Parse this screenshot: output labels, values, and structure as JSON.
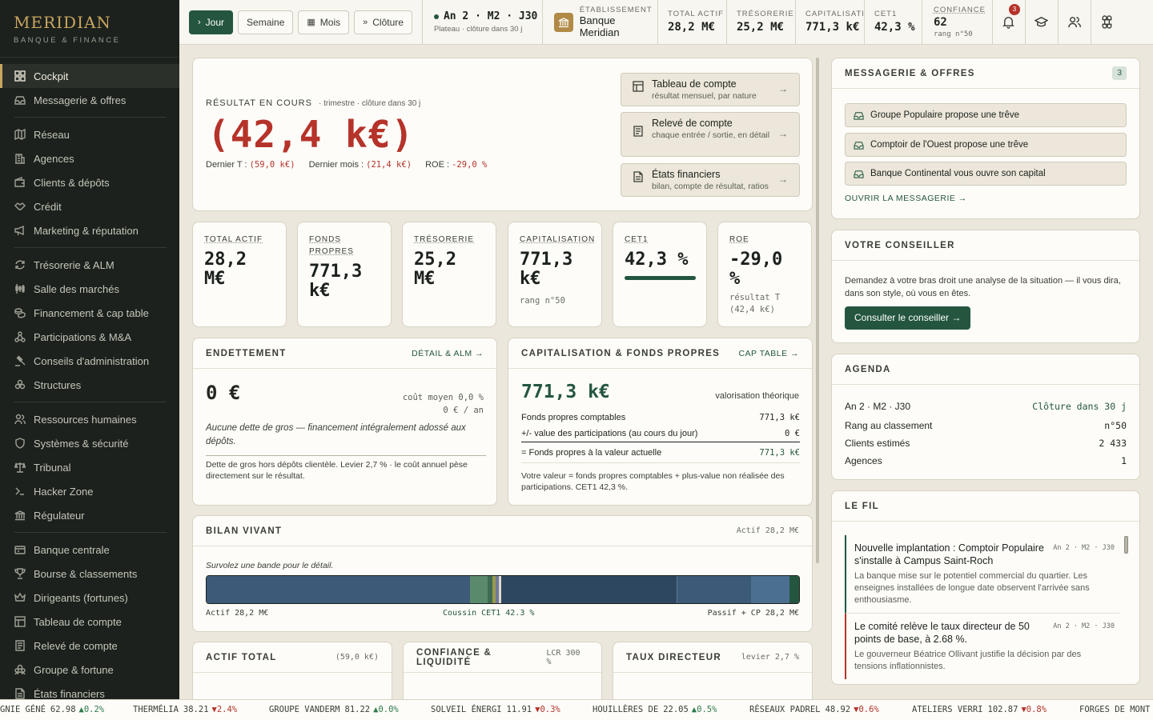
{
  "brand": {
    "name": "MERIDIAN",
    "subtitle": "BANQUE & FINANCE"
  },
  "sidebar": {
    "items": [
      {
        "label": "Cockpit",
        "icon": "dashboard-icon",
        "active": true
      },
      {
        "label": "Messagerie & offres",
        "icon": "inbox-icon"
      },
      {
        "label": "Réseau",
        "icon": "map-icon"
      },
      {
        "label": "Agences",
        "icon": "building-icon"
      },
      {
        "label": "Clients & dépôts",
        "icon": "wallet-icon"
      },
      {
        "label": "Crédit",
        "icon": "handshake-icon"
      },
      {
        "label": "Marketing & réputation",
        "icon": "megaphone-icon"
      },
      {
        "label": "Trésorerie & ALM",
        "icon": "cycle-icon"
      },
      {
        "label": "Salle des marchés",
        "icon": "candles-icon"
      },
      {
        "label": "Financement & cap table",
        "icon": "coins-icon"
      },
      {
        "label": "Participations & M&A",
        "icon": "network-icon"
      },
      {
        "label": "Conseils d'administration",
        "icon": "gavel-icon"
      },
      {
        "label": "Structures",
        "icon": "layers-icon"
      },
      {
        "label": "Ressources humaines",
        "icon": "users-icon"
      },
      {
        "label": "Systèmes & sécurité",
        "icon": "shield-icon"
      },
      {
        "label": "Tribunal",
        "icon": "scales-icon"
      },
      {
        "label": "Hacker Zone",
        "icon": "terminal-icon"
      },
      {
        "label": "Régulateur",
        "icon": "landmark-icon"
      },
      {
        "label": "Banque centrale",
        "icon": "bank-icon"
      },
      {
        "label": "Bourse & classements",
        "icon": "trophy-icon"
      },
      {
        "label": "Dirigeants (fortunes)",
        "icon": "crown-icon"
      },
      {
        "label": "Tableau de compte",
        "icon": "table-icon"
      },
      {
        "label": "Relevé de compte",
        "icon": "receipt-icon"
      },
      {
        "label": "Groupe & fortune",
        "icon": "group-icon"
      },
      {
        "label": "États financiers",
        "icon": "document-icon"
      }
    ]
  },
  "topbar": {
    "buttons": [
      {
        "label": "Jour",
        "glyph": "›"
      },
      {
        "label": "Semaine",
        "glyph": ""
      },
      {
        "label": "Mois",
        "glyph": "▦"
      },
      {
        "label": "Clôture",
        "glyph": "»"
      }
    ],
    "date": "An 2 · M2 · J30",
    "date_sub": "Plateau · clôture dans 30 j",
    "establishment_label": "ÉTABLISSEMENT",
    "establishment": "Banque Meridian",
    "stats": [
      {
        "label": "TOTAL ACTIF",
        "value": "28,2 M€"
      },
      {
        "label": "TRÉSORERIE",
        "value": "25,2 M€"
      },
      {
        "label": "CAPITALISATION",
        "value": "771,3 k€"
      },
      {
        "label": "CET1",
        "value": "42,3 %"
      }
    ],
    "confidence_label": "CONFIANCE",
    "confidence": "62",
    "rank": "rang n°50",
    "notifications": "3"
  },
  "result": {
    "label": "RÉSULTAT EN COURS",
    "context": "· trimestre · clôture dans 30 j",
    "value": "(42,4 k€)",
    "last_t_label": "Dernier T :",
    "last_t": "(59,0 k€)",
    "last_m_label": "Dernier mois :",
    "last_m": "(21,4 k€)",
    "roe_label": "ROE :",
    "roe": "-29,0 %"
  },
  "links": [
    {
      "title": "Tableau de compte",
      "sub": "résultat mensuel, par nature"
    },
    {
      "title": "Relevé de compte",
      "sub": "chaque entrée / sortie, en détail"
    },
    {
      "title": "États financiers",
      "sub": "bilan, compte de résultat, ratios"
    }
  ],
  "kpis": [
    {
      "label": "TOTAL ACTIF",
      "value": "28,2 M€",
      "sub": ""
    },
    {
      "label": "FONDS PROPRES",
      "value": "771,3 k€",
      "sub": ""
    },
    {
      "label": "TRÉSORERIE",
      "value": "25,2 M€",
      "sub": ""
    },
    {
      "label": "CAPITALISATION",
      "value": "771,3 k€",
      "sub": "rang n°50"
    },
    {
      "label": "CET1",
      "value": "42,3 %",
      "sub": ""
    },
    {
      "label": "ROE",
      "value": "-29,0 %",
      "sub": "résultat T (42,4 k€)"
    }
  ],
  "cet1_fill": 0.423,
  "debt": {
    "title": "ENDETTEMENT",
    "link": "DÉTAIL & ALM →",
    "value": "0 €",
    "cost_line1": "coût moyen 0,0 %",
    "cost_line2": "0 € / an",
    "note": "Aucune dette de gros — financement intégralement adossé aux dépôts.",
    "detail": "Dette de gros hors dépôts clientèle. Levier 2,7 % · le coût annuel pèse directement sur le résultat."
  },
  "cap": {
    "title": "CAPITALISATION & FONDS PROPRES",
    "link": "CAP TABLE →",
    "value": "771,3 k€",
    "value_note": "valorisation théorique",
    "rows": [
      {
        "label": "Fonds propres comptables",
        "value": "771,3 k€"
      },
      {
        "label": "+/- value des participations (au cours du jour)",
        "value": "0 €"
      },
      {
        "label": "= Fonds propres à la valeur actuelle",
        "value": "771,3 k€"
      }
    ],
    "note": "Votre valeur = fonds propres comptables + plus-value non réalisée des participations. CET1 42,3 %."
  },
  "bilan": {
    "title": "BILAN VIVANT",
    "right": "Actif 28,2 M€",
    "hint": "Survolez une bande pour le détail.",
    "left_label": "Actif 28,2 M€",
    "mid_label": "Coussin CET1 42.3 %",
    "right_label": "Passif + CP 28,2 M€"
  },
  "bottom_cards": [
    {
      "title": "ACTIF TOTAL",
      "right": "(59,0 k€)"
    },
    {
      "title": "CONFIANCE & LIQUIDITÉ",
      "right": "LCR 300 %"
    },
    {
      "title": "TAUX DIRECTEUR",
      "right": "levier 2,7 %"
    }
  ],
  "messages": {
    "title": "MESSAGERIE & OFFRES",
    "count": "3",
    "items": [
      "Groupe Populaire propose une trêve",
      "Comptoir de l'Ouest propose une trêve",
      "Banque Continental vous ouvre son capital"
    ],
    "open": "OUVRIR LA MESSAGERIE →"
  },
  "advisor": {
    "title": "VOTRE CONSEILLER",
    "text": "Demandez à votre bras droit une analyse de la situation — il vous dira, dans son style, où vous en êtes.",
    "button": "Consulter le conseiller →"
  },
  "agenda": {
    "title": "AGENDA",
    "date": "An 2 · M2 · J30",
    "due": "Clôture dans 30 j",
    "rows": [
      {
        "label": "Rang au classement",
        "value": "n°50"
      },
      {
        "label": "Clients estimés",
        "value": "2 433"
      },
      {
        "label": "Agences",
        "value": "1"
      }
    ]
  },
  "feed": {
    "title": "LE FIL",
    "items": [
      {
        "title": "Nouvelle implantation : Comptoir Populaire s'installe à Campus Saint-Roch",
        "date": "An 2 · M2 · J30",
        "body": "La banque mise sur le potentiel commercial du quartier. Les enseignes installées de longue date observent l'arrivée sans enthousiasme.",
        "accent": "#24563f"
      },
      {
        "title": "Le comité relève le taux directeur de 50 points de base, à 2.68 %.",
        "date": "An 2 · M2 · J30",
        "body": "Le gouverneur Béatrice Ollivant justifie la décision par des tensions inflationnistes.",
        "accent": "#b5332a"
      }
    ]
  },
  "ticker": [
    {
      "name": "GNIE GÉNÉ",
      "price": "62.98",
      "chg": "▲0.2%",
      "dir": "up"
    },
    {
      "name": "THERMÉLIA",
      "price": "38.21",
      "chg": "▼2.4%",
      "dir": "dn"
    },
    {
      "name": "GROUPE VANDERM",
      "price": "81.22",
      "chg": "▲0.0%",
      "dir": "up"
    },
    {
      "name": "SOLVEIL ÉNERGI",
      "price": "11.91",
      "chg": "▼0.3%",
      "dir": "dn"
    },
    {
      "name": "HOUILLÈRES DE",
      "price": "22.05",
      "chg": "▲0.5%",
      "dir": "up"
    },
    {
      "name": "RÉSEAUX PADREL",
      "price": "48.92",
      "chg": "▼0.6%",
      "dir": "dn"
    },
    {
      "name": "ATELIERS VERRI",
      "price": "102.87",
      "chg": "▼0.8%",
      "dir": "dn"
    },
    {
      "name": "FORGES DE MONT",
      "price": "",
      "chg": "",
      "dir": ""
    }
  ],
  "colors": {
    "accent": "#24563f",
    "gold": "#c9a560",
    "negative": "#b5332a"
  }
}
